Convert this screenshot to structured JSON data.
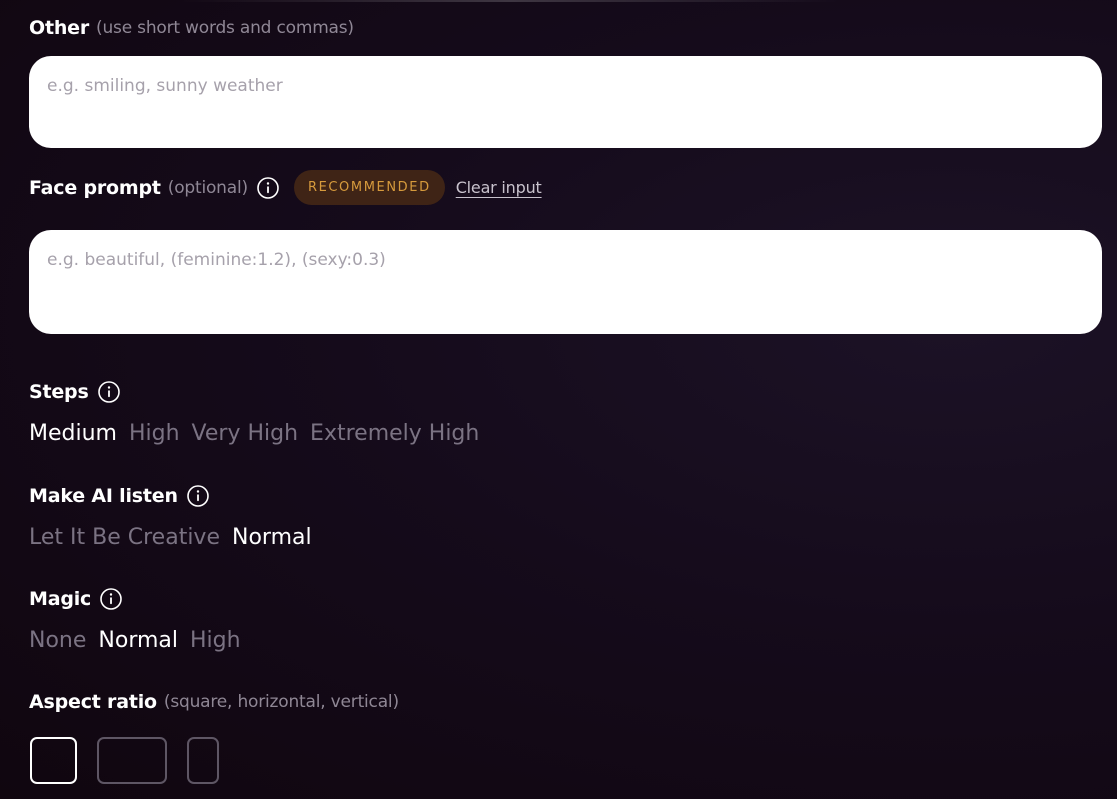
{
  "other": {
    "label": "Other",
    "hint": "(use short words and commas)",
    "placeholder": "e.g. smiling, sunny weather",
    "value": ""
  },
  "face_prompt": {
    "label": "Face prompt",
    "hint": "(optional)",
    "badge": "RECOMMENDED",
    "clear_link": "Clear input",
    "placeholder": "e.g. beautiful, (feminine:1.2), (sexy:0.3)",
    "value": ""
  },
  "steps": {
    "label": "Steps",
    "options": [
      "Medium",
      "High",
      "Very High",
      "Extremely High"
    ],
    "selected": "Medium"
  },
  "make_ai_listen": {
    "label": "Make AI listen",
    "options": [
      "Let It Be Creative",
      "Normal"
    ],
    "selected": "Normal"
  },
  "magic": {
    "label": "Magic",
    "options": [
      "None",
      "Normal",
      "High"
    ],
    "selected": "Normal"
  },
  "aspect_ratio": {
    "label": "Aspect ratio",
    "hint": "(square, horizontal, vertical)",
    "options": [
      "square",
      "horizontal",
      "vertical"
    ],
    "selected": "square"
  },
  "colors": {
    "background": "#150b1b",
    "badge_bg": "#3f2416",
    "badge_text": "#d69a3c",
    "inactive_option": "#7b7383",
    "active_option": "#ffffff"
  }
}
